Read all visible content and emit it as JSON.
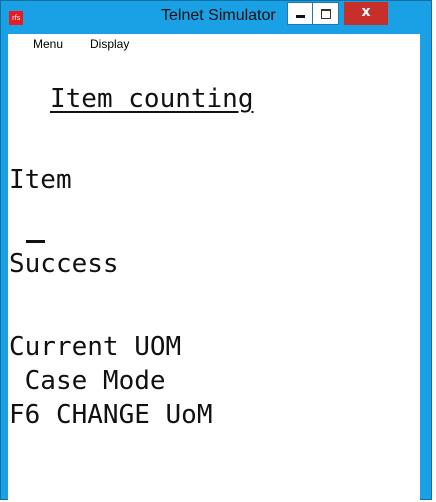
{
  "window": {
    "title": "Telnet Simulator",
    "app_icon_text": "rfs",
    "close_glyph": "x",
    "icons": [
      "app-icon",
      "minimize-icon",
      "maximize-icon",
      "close-icon"
    ]
  },
  "menubar": {
    "items": [
      "Menu",
      "Display"
    ]
  },
  "terminal": {
    "heading": "Item counting",
    "lines": [
      "Item",
      "Success",
      "Current UOM",
      " Case Mode",
      "F6 CHANGE UoM"
    ]
  },
  "colors": {
    "titlebar": "#1aa1e5",
    "close_button": "#c7302a",
    "app_icon": "#e81b23",
    "terminal_background": "#ffffff",
    "terminal_text": "#111111"
  }
}
